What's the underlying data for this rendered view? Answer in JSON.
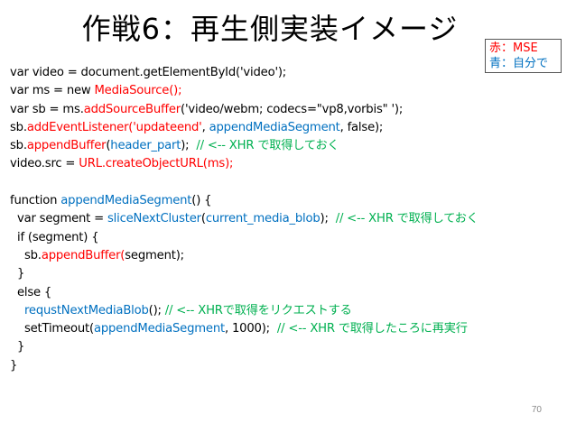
{
  "slide": {
    "title": "作戦6：再生側実装イメージ",
    "legend": {
      "red": "赤：MSE",
      "blue": "青：自分で"
    },
    "page_number": "70",
    "code_lines": [
      [
        {
          "t": "var video = document.getElementById('video');",
          "c": ""
        }
      ],
      [
        {
          "t": "var ms = new ",
          "c": ""
        },
        {
          "t": "MediaSource();",
          "c": "red"
        }
      ],
      [
        {
          "t": "var sb = ms.",
          "c": ""
        },
        {
          "t": "addSourceBuffer",
          "c": "red"
        },
        {
          "t": "('video/webm; codecs=\"vp8,vorbis\" ');",
          "c": ""
        }
      ],
      [
        {
          "t": "sb.",
          "c": ""
        },
        {
          "t": "addEventListener('updateend'",
          "c": "red"
        },
        {
          "t": ", ",
          "c": ""
        },
        {
          "t": "appendMediaSegment",
          "c": "blue"
        },
        {
          "t": ", false);",
          "c": ""
        }
      ],
      [
        {
          "t": "sb.",
          "c": ""
        },
        {
          "t": "appendBuffer",
          "c": "red"
        },
        {
          "t": "(",
          "c": ""
        },
        {
          "t": "header_part",
          "c": "blue"
        },
        {
          "t": ");  ",
          "c": ""
        },
        {
          "t": "// <-- XHR で取得しておく",
          "c": "green"
        }
      ],
      [
        {
          "t": "video.src = ",
          "c": ""
        },
        {
          "t": "URL.createObjectURL(ms);",
          "c": "red"
        }
      ],
      [],
      [
        {
          "t": "function ",
          "c": ""
        },
        {
          "t": "appendMediaSegment",
          "c": "blue"
        },
        {
          "t": "() {",
          "c": ""
        }
      ],
      [
        {
          "t": "  var segment = ",
          "c": ""
        },
        {
          "t": "sliceNextCluster",
          "c": "blue"
        },
        {
          "t": "(",
          "c": ""
        },
        {
          "t": "current_media_blob",
          "c": "blue"
        },
        {
          "t": ");  ",
          "c": ""
        },
        {
          "t": "// <-- XHR で取得しておく",
          "c": "green"
        }
      ],
      [
        {
          "t": "  if (segment) {",
          "c": ""
        }
      ],
      [
        {
          "t": "    sb.",
          "c": ""
        },
        {
          "t": "appendBuffer(",
          "c": "red"
        },
        {
          "t": "segment);",
          "c": ""
        }
      ],
      [
        {
          "t": "  }",
          "c": ""
        }
      ],
      [
        {
          "t": "  else {",
          "c": ""
        }
      ],
      [
        {
          "t": "    ",
          "c": ""
        },
        {
          "t": "requstNextMediaBlob",
          "c": "blue"
        },
        {
          "t": "(); ",
          "c": ""
        },
        {
          "t": "// <-- XHRで取得をリクエストする",
          "c": "green"
        }
      ],
      [
        {
          "t": "    setTimeout(",
          "c": ""
        },
        {
          "t": "appendMediaSegment",
          "c": "blue"
        },
        {
          "t": ", 1000);  ",
          "c": ""
        },
        {
          "t": "// <-- XHR で取得したころに再実行",
          "c": "green"
        }
      ],
      [
        {
          "t": "  }",
          "c": ""
        }
      ],
      [
        {
          "t": "}",
          "c": ""
        }
      ]
    ]
  }
}
